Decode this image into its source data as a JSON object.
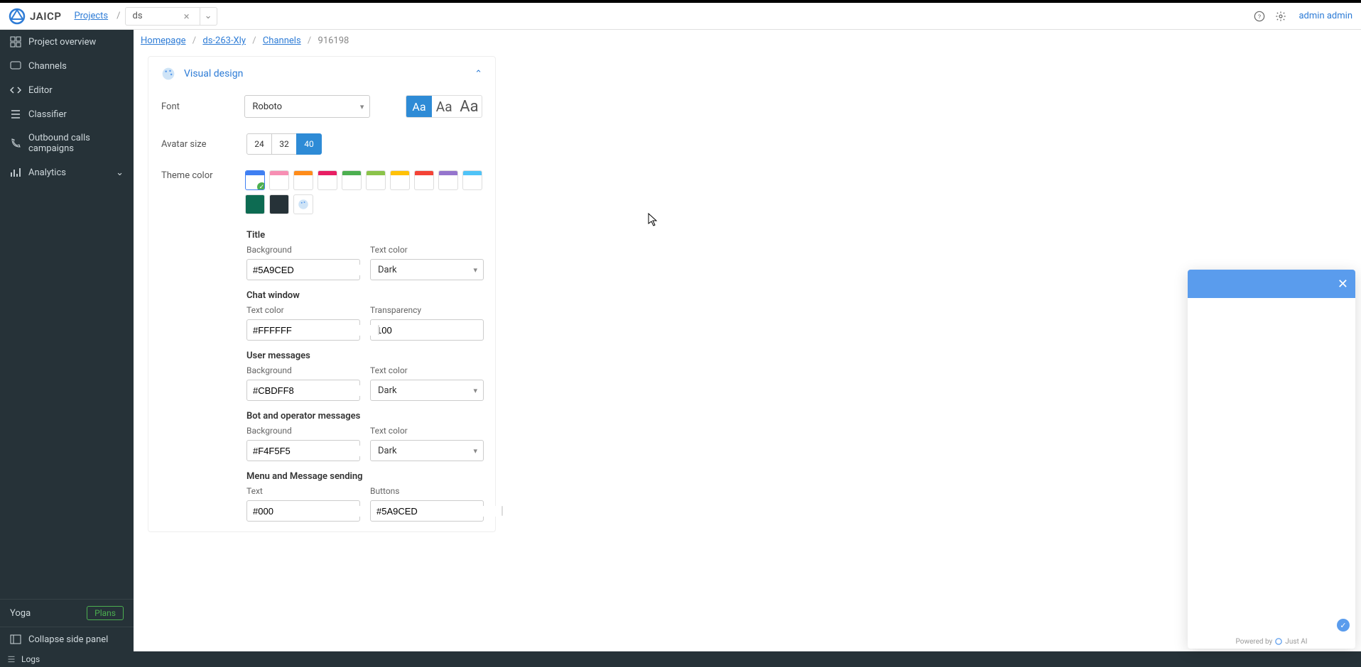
{
  "brand": {
    "name": "JAICP"
  },
  "header": {
    "projects_link": "Projects",
    "project_name": "ds",
    "user": "admin admin"
  },
  "sidebar": {
    "items": [
      {
        "label": "Project overview",
        "icon": "grid"
      },
      {
        "label": "Channels",
        "icon": "comment"
      },
      {
        "label": "Editor",
        "icon": "code"
      },
      {
        "label": "Classifier",
        "icon": "list"
      },
      {
        "label": "Outbound calls campaigns",
        "icon": "phone"
      },
      {
        "label": "Analytics",
        "icon": "chart",
        "caret": true
      }
    ],
    "group": "Yoga",
    "plans": "Plans",
    "collapse": "Collapse side panel"
  },
  "breadcrumb": {
    "home": "Homepage",
    "project": "ds-263-Xly",
    "section": "Channels",
    "id": "916198"
  },
  "panel": {
    "title": "Visual design",
    "font": {
      "label": "Font",
      "value": "Roboto",
      "sizes": [
        "Aa",
        "Aa",
        "Aa"
      ],
      "size_active": 0
    },
    "avatar": {
      "label": "Avatar size",
      "options": [
        "24",
        "32",
        "40"
      ],
      "active": 2
    },
    "theme": {
      "label": "Theme color",
      "swatches_top": [
        "#3f7ff2",
        "#f78fb3",
        "#ff8c1a",
        "#e81e63",
        "#4caf50",
        "#8bc34a",
        "#ffc107",
        "#f44336",
        "#9575cd",
        "#4fc3f7"
      ],
      "swatches_solid": [
        "#1a2b2f",
        "#263238"
      ],
      "selected": 0
    },
    "sections": {
      "title": {
        "heading": "Title",
        "bg_label": "Background",
        "bg_value": "#5A9CED",
        "text_label": "Text color",
        "text_value": "Dark"
      },
      "chat": {
        "heading": "Chat window",
        "text_label": "Text color",
        "text_value": "#FFFFFF",
        "trans_label": "Transparency",
        "trans_value": "100"
      },
      "user_msg": {
        "heading": "User messages",
        "bg_label": "Background",
        "bg_value": "#CBDFF8",
        "text_label": "Text color",
        "text_value": "Dark"
      },
      "bot_msg": {
        "heading": "Bot and operator messages",
        "bg_label": "Background",
        "bg_value": "#F4F5F5",
        "text_label": "Text color",
        "text_value": "Dark"
      },
      "menu": {
        "heading": "Menu and Message sending",
        "text_label": "Text",
        "text_value": "#000",
        "btn_label": "Buttons",
        "btn_value": "#5A9CED"
      }
    }
  },
  "chat_widget": {
    "powered": "Powered by",
    "brand": "Just AI"
  },
  "footer": {
    "logs": "Logs"
  }
}
